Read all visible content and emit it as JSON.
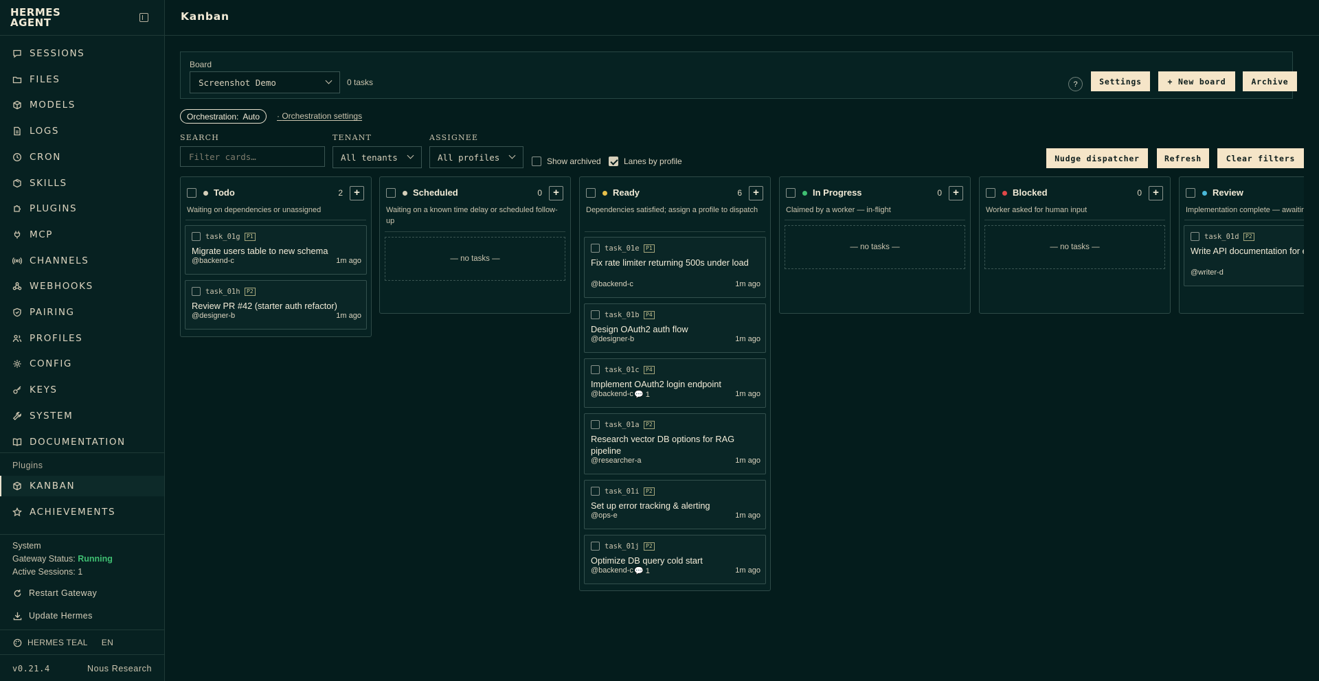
{
  "app": {
    "name": "HERMES AGENT",
    "page_title": "Kanban"
  },
  "sidebar": {
    "items": [
      {
        "label": "SESSIONS",
        "icon": "chat-icon"
      },
      {
        "label": "FILES",
        "icon": "folder-icon"
      },
      {
        "label": "MODELS",
        "icon": "cube-icon"
      },
      {
        "label": "LOGS",
        "icon": "file-icon"
      },
      {
        "label": "CRON",
        "icon": "clock-icon"
      },
      {
        "label": "SKILLS",
        "icon": "package-icon"
      },
      {
        "label": "PLUGINS",
        "icon": "puzzle-icon"
      },
      {
        "label": "MCP",
        "icon": "plug-icon"
      },
      {
        "label": "CHANNELS",
        "icon": "radio-icon"
      },
      {
        "label": "WEBHOOKS",
        "icon": "webhook-icon"
      },
      {
        "label": "PAIRING",
        "icon": "shield-icon"
      },
      {
        "label": "PROFILES",
        "icon": "users-icon"
      },
      {
        "label": "CONFIG",
        "icon": "gear-icon"
      },
      {
        "label": "KEYS",
        "icon": "key-icon"
      },
      {
        "label": "SYSTEM",
        "icon": "wrench-icon"
      },
      {
        "label": "DOCUMENTATION",
        "icon": "book-icon"
      }
    ],
    "plugins_heading": "Plugins",
    "plugins": [
      {
        "label": "KANBAN",
        "icon": "cube-icon",
        "active": true
      },
      {
        "label": "ACHIEVEMENTS",
        "icon": "star-icon"
      }
    ],
    "system": {
      "heading": "System",
      "gateway_label": "Gateway Status:",
      "gateway_value": "Running",
      "sessions_label": "Active Sessions:",
      "sessions_value": "1",
      "restart_label": "Restart Gateway",
      "update_label": "Update Hermes"
    },
    "theme_label": "HERMES TEAL",
    "language": "EN",
    "version": "v0.21.4",
    "org": "Nous Research"
  },
  "board": {
    "label": "Board",
    "selected": "Screenshot Demo",
    "task_count": "0 tasks",
    "help_label": "?",
    "settings_label": "Settings",
    "new_board_label": "+ New board",
    "archive_label": "Archive"
  },
  "orchestration": {
    "pill_label": "Orchestration:",
    "pill_value": "Auto",
    "settings_link": "Orchestration settings"
  },
  "filters": {
    "search_label": "SEARCH",
    "search_placeholder": "Filter cards…",
    "tenant_label": "TENANT",
    "tenant_value": "All tenants",
    "assignee_label": "ASSIGNEE",
    "assignee_value": "All profiles",
    "show_archived_label": "Show archived",
    "show_archived": false,
    "lanes_label": "Lanes by profile",
    "lanes_by_profile": true,
    "nudge_label": "Nudge dispatcher",
    "refresh_label": "Refresh",
    "clear_label": "Clear filters"
  },
  "columns": [
    {
      "title": "Todo",
      "count": "2",
      "dot_color": "#d6cfba",
      "description": "Waiting on dependencies or unassigned",
      "cards": [
        {
          "id": "task_01g",
          "priority": "P1",
          "title": "Migrate users table to new schema",
          "assignee": "@backend-c",
          "time": "1m ago"
        },
        {
          "id": "task_01h",
          "priority": "P2",
          "title": "Review PR #42 (starter auth refactor)",
          "assignee": "@designer-b",
          "time": "1m ago"
        }
      ]
    },
    {
      "title": "Scheduled",
      "count": "0",
      "dot_color": "#d6cfba",
      "description": "Waiting on a known time delay or scheduled follow-up",
      "empty_label": "— no tasks —",
      "cards": []
    },
    {
      "title": "Ready",
      "count": "6",
      "dot_color": "#e8c04a",
      "description": "Dependencies satisfied; assign a profile to dispatch",
      "cards": [
        {
          "id": "task_01e",
          "priority": "P1",
          "title": "Fix rate limiter returning 500s under load",
          "assignee": "@backend-c",
          "time": "1m ago"
        },
        {
          "id": "task_01b",
          "priority": "P4",
          "title": "Design OAuth2 auth flow",
          "assignee": "@designer-b",
          "time": "1m ago"
        },
        {
          "id": "task_01c",
          "priority": "P4",
          "title": "Implement OAuth2 login endpoint",
          "assignee": "@backend-c",
          "comments": "1",
          "time": "1m ago"
        },
        {
          "id": "task_01a",
          "priority": "P2",
          "title": "Research vector DB options for RAG pipeline",
          "assignee": "@researcher-a",
          "time": "1m ago"
        },
        {
          "id": "task_01i",
          "priority": "P2",
          "title": "Set up error tracking & alerting",
          "assignee": "@ops-e",
          "time": "1m ago"
        },
        {
          "id": "task_01j",
          "priority": "P2",
          "title": "Optimize DB query cold start",
          "assignee": "@backend-c",
          "comments": "1",
          "time": "1m ago"
        }
      ]
    },
    {
      "title": "In Progress",
      "count": "0",
      "dot_color": "#3fbf72",
      "description": "Claimed by a worker — in-flight",
      "empty_label": "— no tasks —",
      "cards": []
    },
    {
      "title": "Blocked",
      "count": "0",
      "dot_color": "#e04848",
      "description": "Worker asked for human input",
      "empty_label": "— no tasks —",
      "cards": []
    },
    {
      "title": "Review",
      "count": "",
      "dot_color": "#4ab8d8",
      "description": "Implementation complete — awaiting",
      "cards": [
        {
          "id": "task_01d",
          "priority": "P2",
          "title": "Write API documentation for endpoints",
          "assignee": "@writer-d",
          "time": ""
        }
      ]
    }
  ]
}
